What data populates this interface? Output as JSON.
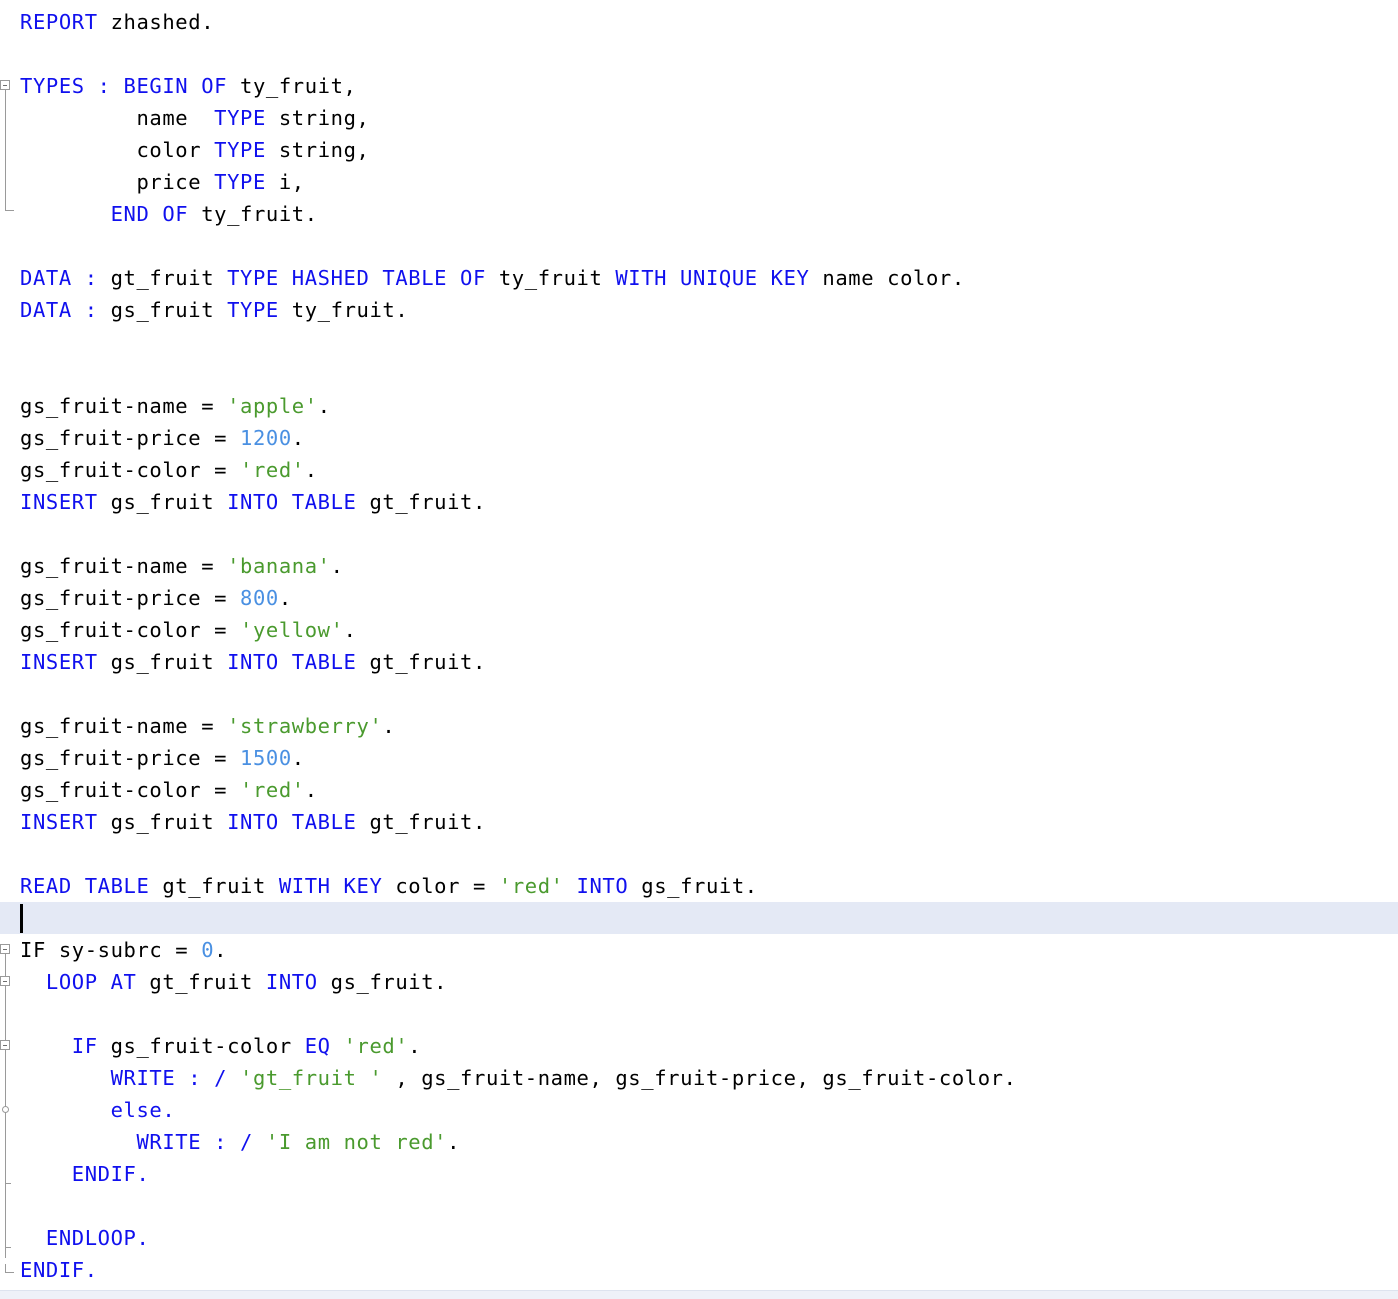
{
  "colors": {
    "keyword": "#1010ee",
    "identifier": "#000000",
    "string": "#4a9a2e",
    "number": "#4a90e2",
    "current_line": "#e4e9f5",
    "fold_marker": "#9a9a9a"
  },
  "editor": {
    "current_line": 28,
    "lines": [
      [
        {
          "t": "REPORT",
          "k": "kw"
        },
        {
          "t": " zhashed.",
          "k": "id"
        }
      ],
      [],
      [
        {
          "t": "TYPES : BEGIN OF",
          "k": "kw"
        },
        {
          "t": " ty_fruit,",
          "k": "id"
        }
      ],
      [
        {
          "t": "         name  ",
          "k": "id"
        },
        {
          "t": "TYPE",
          "k": "kw"
        },
        {
          "t": " string,",
          "k": "id"
        }
      ],
      [
        {
          "t": "         color ",
          "k": "id"
        },
        {
          "t": "TYPE",
          "k": "kw"
        },
        {
          "t": " string,",
          "k": "id"
        }
      ],
      [
        {
          "t": "         price ",
          "k": "id"
        },
        {
          "t": "TYPE",
          "k": "kw"
        },
        {
          "t": " i,",
          "k": "id"
        }
      ],
      [
        {
          "t": "       END OF",
          "k": "kw"
        },
        {
          "t": " ty_fruit.",
          "k": "id"
        }
      ],
      [],
      [
        {
          "t": "DATA :",
          "k": "kw"
        },
        {
          "t": " gt_fruit ",
          "k": "id"
        },
        {
          "t": "TYPE HASHED TABLE OF",
          "k": "kw"
        },
        {
          "t": " ty_fruit ",
          "k": "id"
        },
        {
          "t": "WITH UNIQUE KEY",
          "k": "kw"
        },
        {
          "t": " name color.",
          "k": "id"
        }
      ],
      [
        {
          "t": "DATA :",
          "k": "kw"
        },
        {
          "t": " gs_fruit ",
          "k": "id"
        },
        {
          "t": "TYPE",
          "k": "kw"
        },
        {
          "t": " ty_fruit.",
          "k": "id"
        }
      ],
      [],
      [],
      [
        {
          "t": "gs_fruit-name = ",
          "k": "id"
        },
        {
          "t": "'apple'",
          "k": "str"
        },
        {
          "t": ".",
          "k": "id"
        }
      ],
      [
        {
          "t": "gs_fruit-price = ",
          "k": "id"
        },
        {
          "t": "1200",
          "k": "num"
        },
        {
          "t": ".",
          "k": "id"
        }
      ],
      [
        {
          "t": "gs_fruit-color = ",
          "k": "id"
        },
        {
          "t": "'red'",
          "k": "str"
        },
        {
          "t": ".",
          "k": "id"
        }
      ],
      [
        {
          "t": "INSERT",
          "k": "kw"
        },
        {
          "t": " gs_fruit ",
          "k": "id"
        },
        {
          "t": "INTO TABLE",
          "k": "kw"
        },
        {
          "t": " gt_fruit.",
          "k": "id"
        }
      ],
      [],
      [
        {
          "t": "gs_fruit-name = ",
          "k": "id"
        },
        {
          "t": "'banana'",
          "k": "str"
        },
        {
          "t": ".",
          "k": "id"
        }
      ],
      [
        {
          "t": "gs_fruit-price = ",
          "k": "id"
        },
        {
          "t": "800",
          "k": "num"
        },
        {
          "t": ".",
          "k": "id"
        }
      ],
      [
        {
          "t": "gs_fruit-color = ",
          "k": "id"
        },
        {
          "t": "'yellow'",
          "k": "str"
        },
        {
          "t": ".",
          "k": "id"
        }
      ],
      [
        {
          "t": "INSERT",
          "k": "kw"
        },
        {
          "t": " gs_fruit ",
          "k": "id"
        },
        {
          "t": "INTO TABLE",
          "k": "kw"
        },
        {
          "t": " gt_fruit.",
          "k": "id"
        }
      ],
      [],
      [
        {
          "t": "gs_fruit-name = ",
          "k": "id"
        },
        {
          "t": "'strawberry'",
          "k": "str"
        },
        {
          "t": ".",
          "k": "id"
        }
      ],
      [
        {
          "t": "gs_fruit-price = ",
          "k": "id"
        },
        {
          "t": "1500",
          "k": "num"
        },
        {
          "t": ".",
          "k": "id"
        }
      ],
      [
        {
          "t": "gs_fruit-color = ",
          "k": "id"
        },
        {
          "t": "'red'",
          "k": "str"
        },
        {
          "t": ".",
          "k": "id"
        }
      ],
      [
        {
          "t": "INSERT",
          "k": "kw"
        },
        {
          "t": " gs_fruit ",
          "k": "id"
        },
        {
          "t": "INTO TABLE",
          "k": "kw"
        },
        {
          "t": " gt_fruit.",
          "k": "id"
        }
      ],
      [],
      [
        {
          "t": "READ TABLE",
          "k": "kw"
        },
        {
          "t": " gt_fruit ",
          "k": "id"
        },
        {
          "t": "WITH KEY",
          "k": "kw"
        },
        {
          "t": " color = ",
          "k": "id"
        },
        {
          "t": "'red'",
          "k": "str"
        },
        {
          "t": " ",
          "k": "id"
        },
        {
          "t": "INTO",
          "k": "kw"
        },
        {
          "t": " gs_fruit.",
          "k": "id"
        }
      ],
      [],
      [
        {
          "t": "IF",
          "k": "id"
        },
        {
          "t": " sy-subrc = ",
          "k": "id"
        },
        {
          "t": "0",
          "k": "num"
        },
        {
          "t": ".",
          "k": "id"
        }
      ],
      [
        {
          "t": "  LOOP AT",
          "k": "kw"
        },
        {
          "t": " gt_fruit ",
          "k": "id"
        },
        {
          "t": "INTO",
          "k": "kw"
        },
        {
          "t": " gs_fruit.",
          "k": "id"
        }
      ],
      [],
      [
        {
          "t": "    IF",
          "k": "kw"
        },
        {
          "t": " gs_fruit-color ",
          "k": "id"
        },
        {
          "t": "EQ",
          "k": "kw"
        },
        {
          "t": " ",
          "k": "id"
        },
        {
          "t": "'red'",
          "k": "str"
        },
        {
          "t": ".",
          "k": "id"
        }
      ],
      [
        {
          "t": "       WRITE : /",
          "k": "kw"
        },
        {
          "t": " ",
          "k": "id"
        },
        {
          "t": "'gt_fruit '",
          "k": "str"
        },
        {
          "t": " , gs_fruit-name, gs_fruit-price, gs_fruit-color.",
          "k": "id"
        }
      ],
      [
        {
          "t": "       else.",
          "k": "kw"
        }
      ],
      [
        {
          "t": "         WRITE : /",
          "k": "kw"
        },
        {
          "t": " ",
          "k": "id"
        },
        {
          "t": "'I am not red'",
          "k": "str"
        },
        {
          "t": ".",
          "k": "id"
        }
      ],
      [
        {
          "t": "    ENDIF.",
          "k": "kw"
        }
      ],
      [],
      [
        {
          "t": "  ENDLOOP.",
          "k": "kw"
        }
      ],
      [
        {
          "t": "ENDIF.",
          "k": "kw"
        }
      ]
    ]
  }
}
